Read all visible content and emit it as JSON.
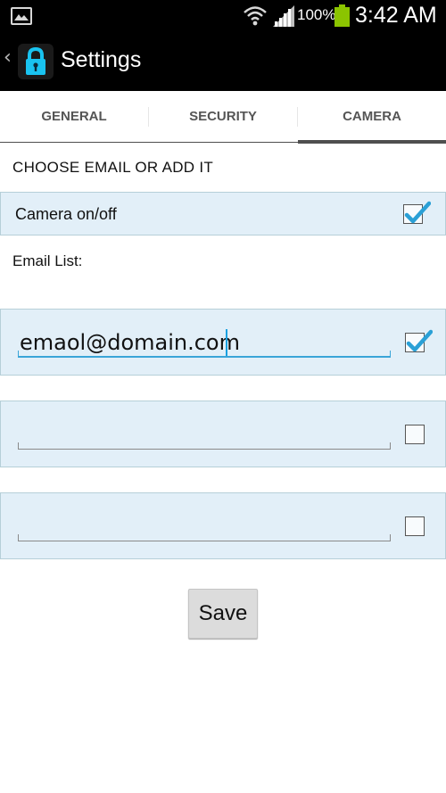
{
  "status_bar": {
    "battery_percent": "100%",
    "battery_level": 1.0,
    "time": "3:42 AM"
  },
  "action_bar": {
    "up_glyph": "‹",
    "title": "Settings",
    "icon": "lock-icon"
  },
  "tabs": [
    {
      "label": "GENERAL",
      "selected": false
    },
    {
      "label": "SECURITY",
      "selected": false
    },
    {
      "label": "CAMERA",
      "selected": true
    }
  ],
  "content": {
    "heading": "CHOOSE EMAIL OR ADD IT",
    "camera_toggle": {
      "label": "Camera on/off",
      "checked": true
    },
    "email_list_label": "Email List:",
    "emails": [
      {
        "value": "emaol@domain.com",
        "checked": true
      },
      {
        "value": "",
        "checked": false
      },
      {
        "value": "",
        "checked": false
      }
    ],
    "save_label": "Save"
  },
  "colors": {
    "accent": "#33b5e5",
    "row_background": "#e2eff8",
    "battery": "#8bc400"
  }
}
